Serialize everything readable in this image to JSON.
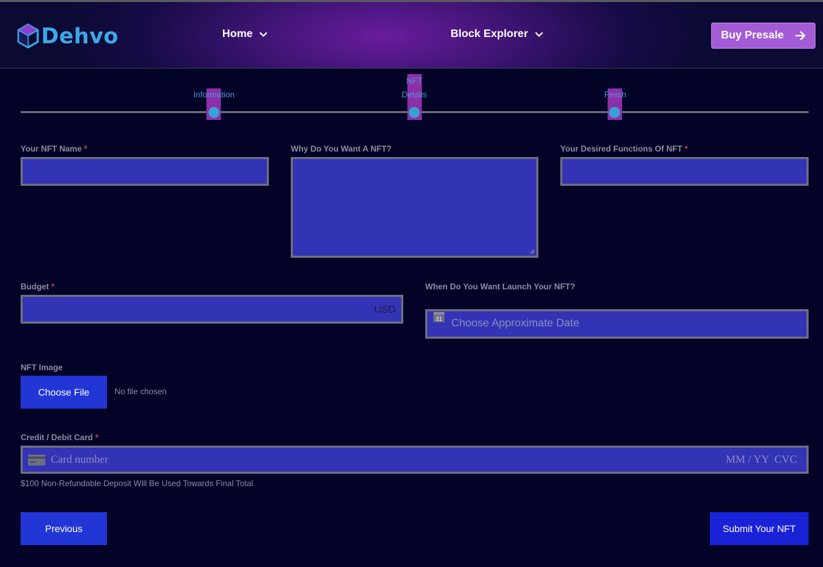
{
  "brand": {
    "name": "Dehvo"
  },
  "nav": {
    "home": "Home",
    "block_explorer": "Block Explorer",
    "buy_presale": "Buy Presale"
  },
  "steps": [
    {
      "label": "Information"
    },
    {
      "label": "NFT Details"
    },
    {
      "label": "Finish"
    }
  ],
  "form": {
    "nft_name_label": "Your NFT Name",
    "why_label": "Why Do You Want A NFT?",
    "functions_label": "Your Desired Functions Of NFT",
    "required_mark": "*",
    "budget_label": "Budget",
    "budget_suffix": "USD",
    "launch_label": "When Do You Want Launch Your NFT?",
    "date_placeholder": "Choose Approximate Date",
    "calendar_day": "31",
    "image_label": "NFT Image",
    "choose_file": "Choose File",
    "no_file": "No file chosen",
    "card_label": "Credit / Debit Card",
    "card_placeholder": "Card number",
    "card_expiry_cvc": "MM / YY  CVC",
    "deposit_note": "$100 Non-Refundable Deposit Will Be Used Towards Final Total",
    "previous": "Previous",
    "submit": "Submit Your NFT"
  },
  "colors": {
    "background": "#030327",
    "field_fill": "#3333b5",
    "field_border": "#6f6f82",
    "button": "#2236d6",
    "submit_button": "#1a22d8",
    "buy_button": "#a35bd6",
    "logo": "#3ba9e8",
    "step_dot": "#38a2d4",
    "step_marker": "#8d2fa8",
    "required": "#d93a5a"
  },
  "icons": {
    "logo": "hexagon-cube-icon",
    "nav_dropdown": "chevron-down-icon",
    "buy": "arrow-right-icon",
    "date": "calendar-icon",
    "card": "credit-card-icon"
  }
}
